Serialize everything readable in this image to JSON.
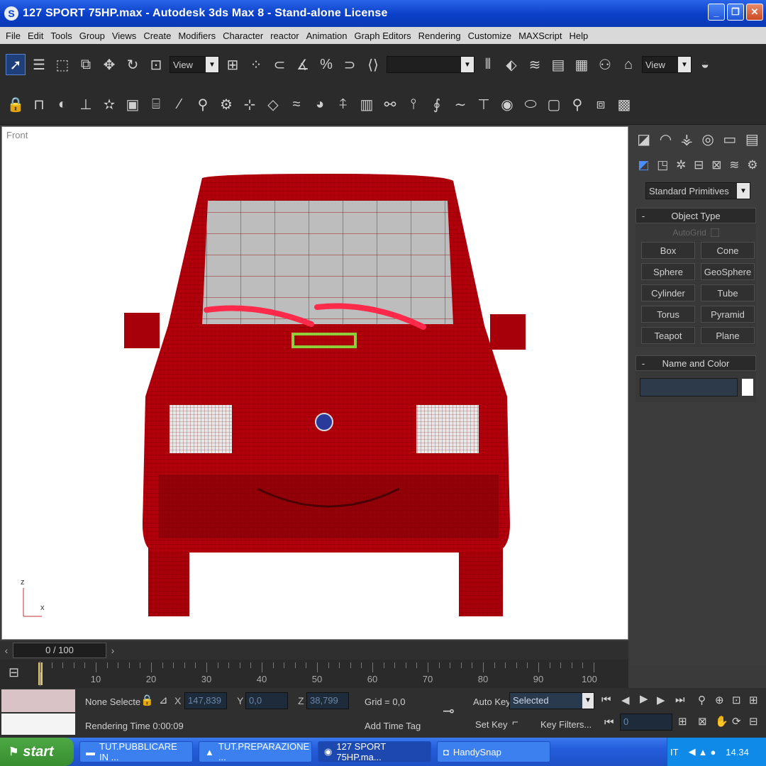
{
  "window": {
    "title": "127 SPORT 75HP.max - Autodesk 3ds Max 8  - Stand-alone License"
  },
  "menu": [
    "File",
    "Edit",
    "Tools",
    "Group",
    "Views",
    "Create",
    "Modifiers",
    "Character",
    "reactor",
    "Animation",
    "Graph Editors",
    "Rendering",
    "Customize",
    "MAXScript",
    "Help"
  ],
  "toolbar": {
    "ref_coord": "View",
    "view_right": "View",
    "selection_set": ""
  },
  "viewport": {
    "label": "Front",
    "axis_z": "z",
    "axis_x": "x"
  },
  "command_panel": {
    "category": "Standard Primitives",
    "object_type_title": "Object Type",
    "autogrid_label": "AutoGrid",
    "object_buttons": [
      "Box",
      "Cone",
      "Sphere",
      "GeoSphere",
      "Cylinder",
      "Tube",
      "Torus",
      "Pyramid",
      "Teapot",
      "Plane"
    ],
    "name_color_title": "Name and Color"
  },
  "timeline": {
    "frame": "0 / 100",
    "ticks": [
      "10",
      "20",
      "30",
      "40",
      "50",
      "60",
      "70",
      "80",
      "90",
      "100"
    ]
  },
  "status": {
    "selection": "None Selecte",
    "render_time": "Rendering Time  0:00:09",
    "x_label": "X",
    "x_val": "147,839",
    "y_label": "Y",
    "y_val": "0,0",
    "z_label": "Z",
    "z_val": "38,799",
    "grid": "Grid = 0,0",
    "add_time_tag": "Add Time Tag",
    "auto_key": "Auto Key",
    "set_key": "Set Key",
    "key_mode": "Selected",
    "key_filters": "Key Filters...",
    "current_frame": "0"
  },
  "taskbar": {
    "start": "start",
    "tasks": [
      "TUT.PUBBLICARE IN ...",
      "TUT.PREPARAZIONE ...",
      "127 SPORT 75HP.ma...",
      "HandySnap"
    ],
    "lang": "IT",
    "clock": "14.34"
  }
}
